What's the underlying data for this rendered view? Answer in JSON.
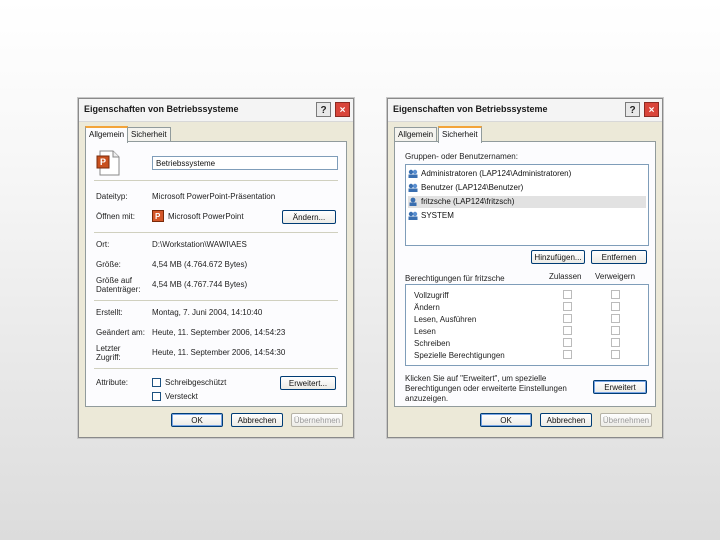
{
  "window1": {
    "title": "Eigenschaften von Betriebssysteme",
    "tabs": [
      "Allgemein",
      "Sicherheit"
    ],
    "name_value": "Betriebssysteme",
    "fields": {
      "typ_label": "Dateityp:",
      "typ_value": "Microsoft PowerPoint-Präsentation",
      "open_label": "Öffnen mit:",
      "open_value": "Microsoft PowerPoint",
      "change_button": "Ändern...",
      "ort_label": "Ort:",
      "ort_value": "D:\\Workstation\\WAWI\\AES",
      "size_label": "Größe:",
      "size_value": "4,54 MB (4.764.672 Bytes)",
      "disk_label_1": "Größe auf",
      "disk_label_2": "Datenträger:",
      "disk_value": "4,54 MB (4.767.744 Bytes)",
      "created_label": "Erstellt:",
      "created_value": "Montag, 7. Juni 2004, 14:10:40",
      "modified_label": "Geändert am:",
      "modified_value": "Heute, 11. September 2006, 14:54:23",
      "access_label_1": "Letzter",
      "access_label_2": "Zugriff:",
      "access_value": "Heute, 11. September 2006, 14:54:30",
      "attr_label": "Attribute:",
      "readonly_label": "Schreibgeschützt",
      "hidden_label": "Versteckt",
      "advanced_button": "Erweitert..."
    },
    "buttons": {
      "ok": "OK",
      "cancel": "Abbrechen",
      "apply": "Übernehmen"
    }
  },
  "window2": {
    "title": "Eigenschaften von Betriebssysteme",
    "tabs": [
      "Allgemein",
      "Sicherheit"
    ],
    "groups_label": "Gruppen- oder Benutzernamen:",
    "users": [
      "Administratoren (LAP124\\Administratoren)",
      "Benutzer (LAP124\\Benutzer)",
      "fritzsche (LAP124\\fritzsch)",
      "SYSTEM"
    ],
    "add_button": "Hinzufügen...",
    "remove_button": "Entfernen",
    "perm_label": "Berechtigungen für fritzsche",
    "allow_label": "Zulassen",
    "deny_label": "Verweigern",
    "permissions": [
      "Vollzugriff",
      "Ändern",
      "Lesen, Ausführen",
      "Lesen",
      "Schreiben",
      "Spezielle Berechtigungen"
    ],
    "advanced_text_1": "Klicken Sie auf \"Erweitert\", um spezielle",
    "advanced_text_2": "Berechtigungen oder erweiterte Einstellungen",
    "advanced_text_3": "anzuzeigen.",
    "advanced_button": "Erweitert",
    "buttons": {
      "ok": "OK",
      "cancel": "Abbrechen",
      "apply": "Übernehmen"
    }
  }
}
